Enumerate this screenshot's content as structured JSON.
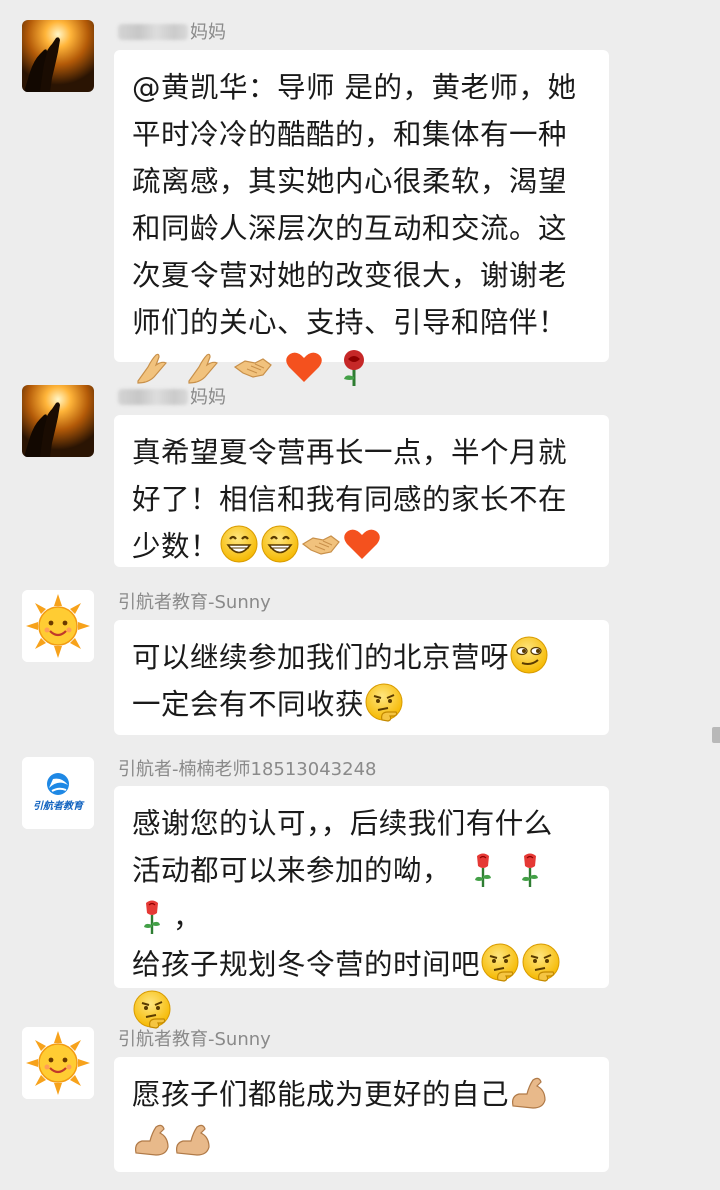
{
  "messages": [
    {
      "sender": "妈妈",
      "sender_blurred": true,
      "avatar_icon": "praying-hands-sunset-avatar",
      "lines": [
        "@黄凯华：导师 是的，黄老师，她",
        "平时冷冷的酷酷的，和集体有一种",
        "疏离感，其实她内心很柔软，渴望",
        "和同龄人深层次的互动和交流。这",
        "次夏令营对她的改变很大，谢谢老",
        "师们的关心、支持、引导和陪伴！"
      ],
      "emoji": [
        "folded-hands-icon",
        "folded-hands-icon",
        "handshake-icon",
        "heart-icon",
        "rose-icon"
      ]
    },
    {
      "sender": "妈妈",
      "sender_blurred": true,
      "avatar_icon": "praying-hands-sunset-avatar",
      "lines": [
        "真希望夏令营再长一点，半个月就",
        "好了！相信和我有同感的家长不在",
        "少数！"
      ],
      "emoji": [
        "grinning-face-icon",
        "grinning-face-icon",
        "handshake-icon",
        "heart-icon"
      ]
    },
    {
      "sender": "引航者教育-Sunny",
      "sender_blurred": false,
      "avatar_icon": "sun-avatar",
      "lines": [
        "可以继续参加我们的北京营呀",
        "一定会有不同收获"
      ],
      "emoji_after_lines": [
        "smirk-face-icon",
        "thinking-face-icon"
      ]
    },
    {
      "sender": "引航者-楠楠老师18513043248",
      "sender_blurred": false,
      "avatar_icon": "yinhangzhe-logo-avatar",
      "logo_text": "引航者教育",
      "lines": [
        "感谢您的认可，，后续我们有什么",
        "活动都可以来参加的呦，",
        "给孩子规划冬令营的时间吧"
      ],
      "line2_suffix": "，"
    },
    {
      "sender": "引航者教育-Sunny",
      "sender_blurred": false,
      "avatar_icon": "sun-avatar",
      "lines": [
        "愿孩子们都能成为更好的自己"
      ]
    }
  ],
  "colors": {
    "background": "#ededed",
    "bubble": "#ffffff",
    "sender_text": "#8a8a8a",
    "message_text": "#1a1a1a"
  }
}
